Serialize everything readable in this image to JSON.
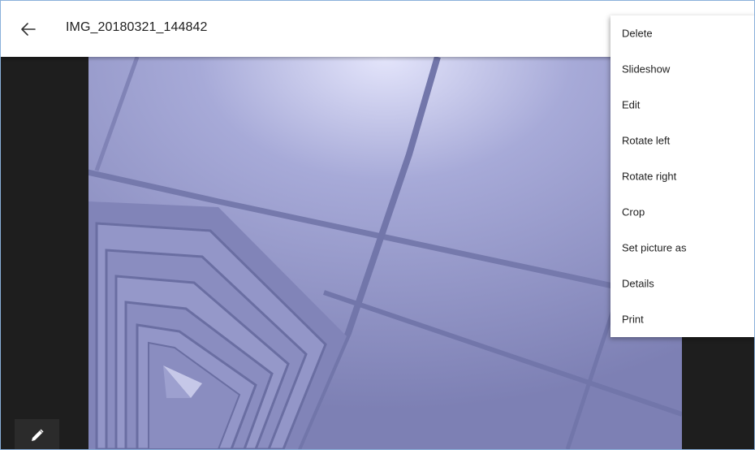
{
  "appbar": {
    "title": "IMG_20180321_144842",
    "back_icon": "arrow-back-icon"
  },
  "viewer": {
    "edit_icon": "pencil-icon"
  },
  "menu": {
    "items": [
      {
        "label": "Delete"
      },
      {
        "label": "Slideshow"
      },
      {
        "label": "Edit"
      },
      {
        "label": "Rotate left"
      },
      {
        "label": "Rotate right"
      },
      {
        "label": "Crop"
      },
      {
        "label": "Set picture as"
      },
      {
        "label": "Details"
      },
      {
        "label": "Print"
      }
    ]
  },
  "colors": {
    "appbar": "#ffffff",
    "viewer_bg": "#1e1e1e",
    "menu_bg": "#ffffff",
    "text": "#212121",
    "window_border": "#8ab0da"
  }
}
